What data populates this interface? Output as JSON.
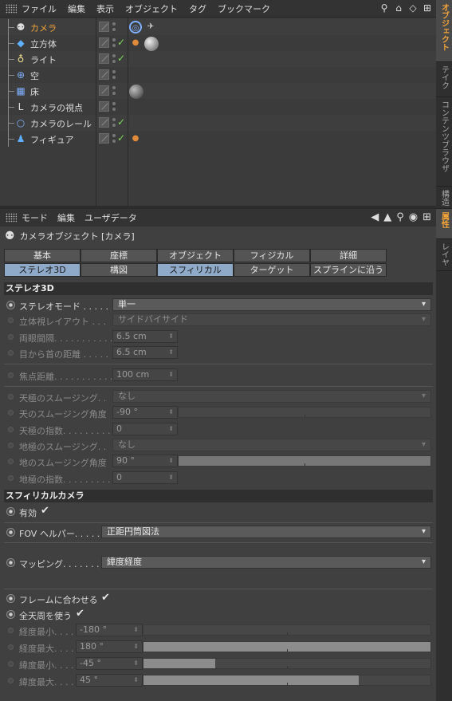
{
  "menubar": {
    "items": [
      "ファイル",
      "編集",
      "表示",
      "オブジェクト",
      "タグ",
      "ブックマーク"
    ]
  },
  "side_tabs": [
    "オブジェクト",
    "テイク",
    "コンテンツブラウザ",
    "構造",
    "属性",
    "レイヤ"
  ],
  "objects": [
    {
      "name": "カメラ",
      "icon": "camera-icon",
      "selected": true,
      "check": false
    },
    {
      "name": "立方体",
      "icon": "cube-icon",
      "selected": false,
      "check": true
    },
    {
      "name": "ライト",
      "icon": "light-icon",
      "selected": false,
      "check": true
    },
    {
      "name": "空",
      "icon": "sky-icon",
      "selected": false,
      "check": false
    },
    {
      "name": "床",
      "icon": "floor-icon",
      "selected": false,
      "check": false
    },
    {
      "name": "カメラの視点",
      "icon": "target-icon",
      "selected": false,
      "check": false
    },
    {
      "name": "カメラのレール",
      "icon": "spline-circle-icon",
      "selected": false,
      "check": true
    },
    {
      "name": "フィギュア",
      "icon": "figure-icon",
      "selected": false,
      "check": true
    }
  ],
  "attr_menu": {
    "items": [
      "モード",
      "編集",
      "ユーザデータ"
    ]
  },
  "object_title": "カメラオブジェクト [カメラ]",
  "tabs_row1": [
    "基本",
    "座標",
    "オブジェクト",
    "フィジカル",
    "詳細"
  ],
  "tabs_row2": [
    "ステレオ3D",
    "構図",
    "スフィリカル",
    "ターゲット",
    "スプラインに沿う"
  ],
  "section_stereo": "ステレオ3D",
  "stereo": {
    "mode_label": "ステレオモード . . . . .",
    "mode_value": "単一",
    "layout_label": "立体視レイアウト . . .",
    "layout_value": "サイドバイサイド",
    "eye_sep_label": "両眼間隔. . . . . . . . . . .",
    "eye_sep_value": "6.5 cm",
    "eye_neck_label": "目から首の距離 . . . . .",
    "eye_neck_value": "6.5 cm",
    "focus_label": "焦点距離. . . . . . . . . . .",
    "focus_value": "100 cm",
    "zenith_smooth_label": "天極のスムージング. .",
    "zenith_smooth_value": "なし",
    "zenith_angle_label": "天のスムージング角度",
    "zenith_angle_value": "-90 °",
    "zenith_exp_label": "天極の指数. . . . . . . . .",
    "zenith_exp_value": "0",
    "nadir_smooth_label": "地極のスムージング. .",
    "nadir_smooth_value": "なし",
    "nadir_angle_label": "地のスムージング角度",
    "nadir_angle_value": "90 °",
    "nadir_exp_label": "地極の指数. . . . . . . . .",
    "nadir_exp_value": "0"
  },
  "section_spherical": "スフィリカルカメラ",
  "spherical": {
    "enabled_label": "有効",
    "fov_label": "FOV ヘルパー. . . . . .",
    "fov_value": "正距円筒図法",
    "mapping_label": "マッピング. . . . . . . .",
    "mapping_value": "緯度経度",
    "fit_frame_label": "フレームに合わせる",
    "full_dome_label": "全天周を使う",
    "lon_min_label": "経度最小. . . .",
    "lon_min_value": "-180 °",
    "lon_max_label": "経度最大. . . .",
    "lon_max_value": "180 °",
    "lat_min_label": "緯度最小. . . .",
    "lat_min_value": "-45 °",
    "lat_max_label": "緯度最大. . . .",
    "lat_max_value": "45 °",
    "lon_max_fill": 1.0,
    "lat_min_fill": 0.25,
    "lat_max_fill": 0.75,
    "nadir_angle_fill": 1.0,
    "lon_min_fill": 0.0
  },
  "colors": {
    "accent": "#f2a33a",
    "active_tab": "#8fa9c8",
    "check_green": "#7ed85a"
  }
}
